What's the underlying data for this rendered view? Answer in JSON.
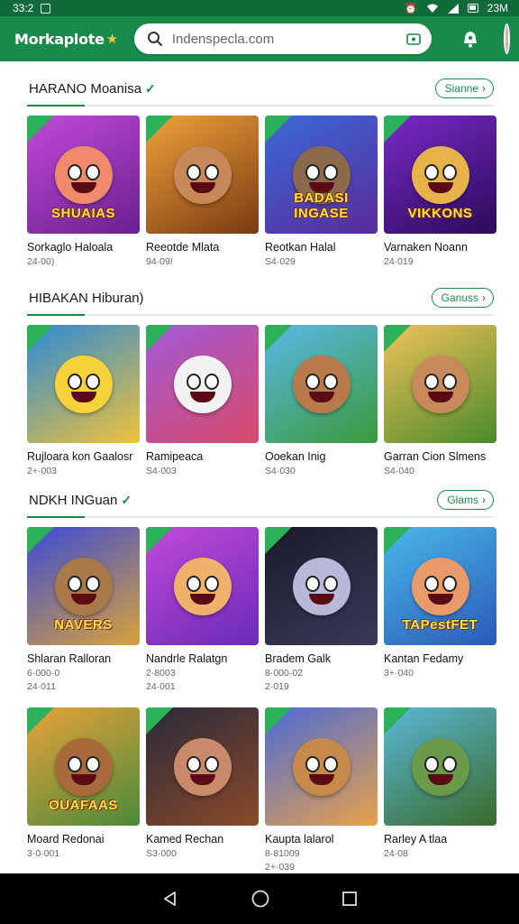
{
  "status_bar": {
    "time": "33:2",
    "right_text": "23M"
  },
  "app_bar": {
    "logo": "Morkaplote",
    "search_placeholder": "Indenspecla.com"
  },
  "sections": [
    {
      "title": "HARANO Moanisa",
      "verified": true,
      "more_label": "Sianne",
      "cards": [
        {
          "name": "Sorkaglo Haloala",
          "meta1": "24·00)",
          "meta2": "",
          "art_title": "SHUAIAS",
          "colors": [
            "#c24ad8",
            "#6a1f8f"
          ],
          "face": "#f08a6a",
          "icon": ""
        },
        {
          "name": "Reeotde Mlata",
          "meta1": "94·09!",
          "meta2": "",
          "art_title": "",
          "colors": [
            "#f0a23a",
            "#7a3a12"
          ],
          "face": "#c8885a",
          "icon": ""
        },
        {
          "name": "Reotkan Halal",
          "meta1": "S4·029",
          "meta2": "",
          "art_title": "BADASI INGASE",
          "colors": [
            "#3a6ad8",
            "#5a2a9a"
          ],
          "face": "#8a6a4a",
          "icon": ""
        },
        {
          "name": "Varnaken Noann",
          "meta1": "24·019",
          "meta2": "",
          "art_title": "VIKKONS",
          "colors": [
            "#7a2ac8",
            "#2a0a5a"
          ],
          "face": "#e8b24a",
          "icon": ""
        }
      ]
    },
    {
      "title": "HIBAKAN Hiburan)",
      "verified": false,
      "more_label": "Ganuss",
      "cards": [
        {
          "name": "Rujloara kon Gaalosr",
          "meta1": "2+·003",
          "meta2": "",
          "art_title": "",
          "colors": [
            "#2a8ad8",
            "#f0c23a"
          ],
          "face": "#f5d23a",
          "icon": ""
        },
        {
          "name": "Ramipeaca",
          "meta1": "S4·003",
          "meta2": "",
          "art_title": "",
          "colors": [
            "#a25ad8",
            "#d84a6a"
          ],
          "face": "#f2f2f2",
          "icon": ""
        },
        {
          "name": "Ooekan Inig",
          "meta1": "S4·030",
          "meta2": "",
          "art_title": "",
          "colors": [
            "#5ab8e8",
            "#3a9a3a"
          ],
          "face": "#b87a4a",
          "icon": ""
        },
        {
          "name": "Garran Cion Slmens",
          "meta1": "S4·040",
          "meta2": "",
          "art_title": "",
          "colors": [
            "#f0c25a",
            "#4a8a2a"
          ],
          "face": "#c88a5a",
          "icon": ""
        }
      ]
    },
    {
      "title": "NDKH INGuan",
      "verified": true,
      "more_label": "Glams",
      "cards": [
        {
          "name": "Shlaran Ralloran",
          "meta1": "6·000·0",
          "meta2": "24·011",
          "art_title": "NAVERS",
          "colors": [
            "#3a4ad8",
            "#d8a23a"
          ],
          "face": "#a87a4a",
          "icon": ""
        },
        {
          "name": "Nandrle Ralatgn",
          "meta1": "2·8003",
          "meta2": "24·001",
          "art_title": "",
          "colors": [
            "#c24ad8",
            "#6a2ab8"
          ],
          "face": "#f0b26a",
          "icon": ""
        },
        {
          "name": "Bradem Galk",
          "meta1": "8·000·02",
          "meta2": "2·019",
          "art_title": "",
          "colors": [
            "#1a1a2a",
            "#3a3a5a"
          ],
          "face": "#b8b8d8",
          "icon": ""
        },
        {
          "name": "Kantan Fedamy",
          "meta1": "3+·040",
          "meta2": "",
          "art_title": "TAPestFET",
          "colors": [
            "#4ab8e8",
            "#2a5ab8"
          ],
          "face": "#e89a6a",
          "icon": ""
        }
      ]
    },
    {
      "title": "",
      "verified": false,
      "more_label": "",
      "cards": [
        {
          "name": "Moard Redonai",
          "meta1": "3·0·001",
          "meta2": "",
          "art_title": "OUAFAAS",
          "colors": [
            "#e8a23a",
            "#4a8a3a"
          ],
          "face": "#a86a3a",
          "icon": ""
        },
        {
          "name": "Kamed Rechan",
          "meta1": "S3·000",
          "meta2": "",
          "art_title": "",
          "colors": [
            "#2a2a3a",
            "#8a4a2a"
          ],
          "face": "#c88a6a",
          "icon": ""
        },
        {
          "name": "Kaupta lalarol",
          "meta1": "8·81009",
          "meta2": "2+·039",
          "art_title": "",
          "colors": [
            "#4a6ad8",
            "#e8a24a"
          ],
          "face": "#c88a4a",
          "icon": ""
        },
        {
          "name": "Rarley A tlaa",
          "meta1": "24·08",
          "meta2": "",
          "art_title": "",
          "colors": [
            "#5ab8d8",
            "#3a6a2a"
          ],
          "face": "#6a9a4a",
          "icon": ""
        }
      ]
    }
  ],
  "icons": {
    "status_left": [
      "square-notification-icon"
    ],
    "status_right": [
      "alarm-icon",
      "wifi-icon",
      "signal-icon",
      "battery-icon"
    ],
    "nav": [
      "back-icon",
      "home-icon",
      "recents-icon"
    ]
  },
  "colors": {
    "brand": "#178c4a",
    "status_bar": "#0f6b3a",
    "accent": "#2cb05a"
  }
}
